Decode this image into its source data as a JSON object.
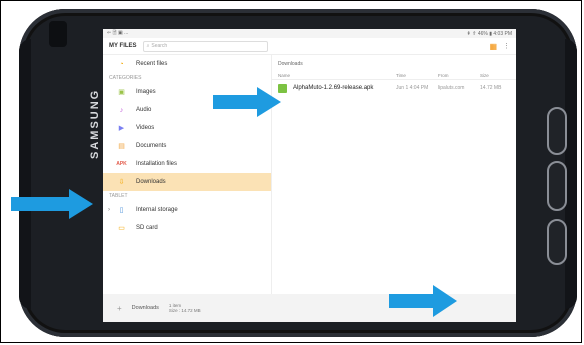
{
  "status": {
    "left": "⇐ 🗎 ▣ ...",
    "right": "⇞ ⇑ 46% ▮ 4:03 PM"
  },
  "topbar": {
    "title": "MY FILES",
    "search_placeholder": "Search"
  },
  "sidebar": {
    "recent": "Recent files",
    "categories_label": "CATEGORIES",
    "items": [
      {
        "label": "Images",
        "icon": "image-icon",
        "color": "#9bc34a"
      },
      {
        "label": "Audio",
        "icon": "music-icon",
        "color": "#c15ad9"
      },
      {
        "label": "Videos",
        "icon": "video-icon",
        "color": "#7a7ff2"
      },
      {
        "label": "Documents",
        "icon": "document-icon",
        "color": "#f0a542"
      },
      {
        "label": "Installation files",
        "icon": "apk-label-icon",
        "color": "#e25a4a"
      },
      {
        "label": "Downloads",
        "icon": "download-icon",
        "color": "#f2a600"
      }
    ],
    "tablet_label": "TABLET",
    "storage": [
      {
        "label": "Internal storage",
        "icon": "phone-storage-icon"
      },
      {
        "label": "SD card",
        "icon": "sd-card-icon"
      }
    ]
  },
  "content": {
    "breadcrumb": "Downloads",
    "headers": {
      "name": "Name",
      "time": "Time",
      "from": "From",
      "size": "Size"
    },
    "files": [
      {
        "name": "AlphaMuto-1.2.69-release.apk",
        "time": "Jun 1 4:04 PM",
        "from": "lipaluts.com",
        "size": "14.72 MB"
      }
    ]
  },
  "bottombar": {
    "label": "Downloads",
    "items": "1 item",
    "size": "Size : 14.72 MB"
  },
  "device": {
    "brand": "SAMSUNG"
  },
  "colors": {
    "arrow": "#1e9be0",
    "accent": "#f28c00",
    "selected": "#fbe2b5"
  }
}
